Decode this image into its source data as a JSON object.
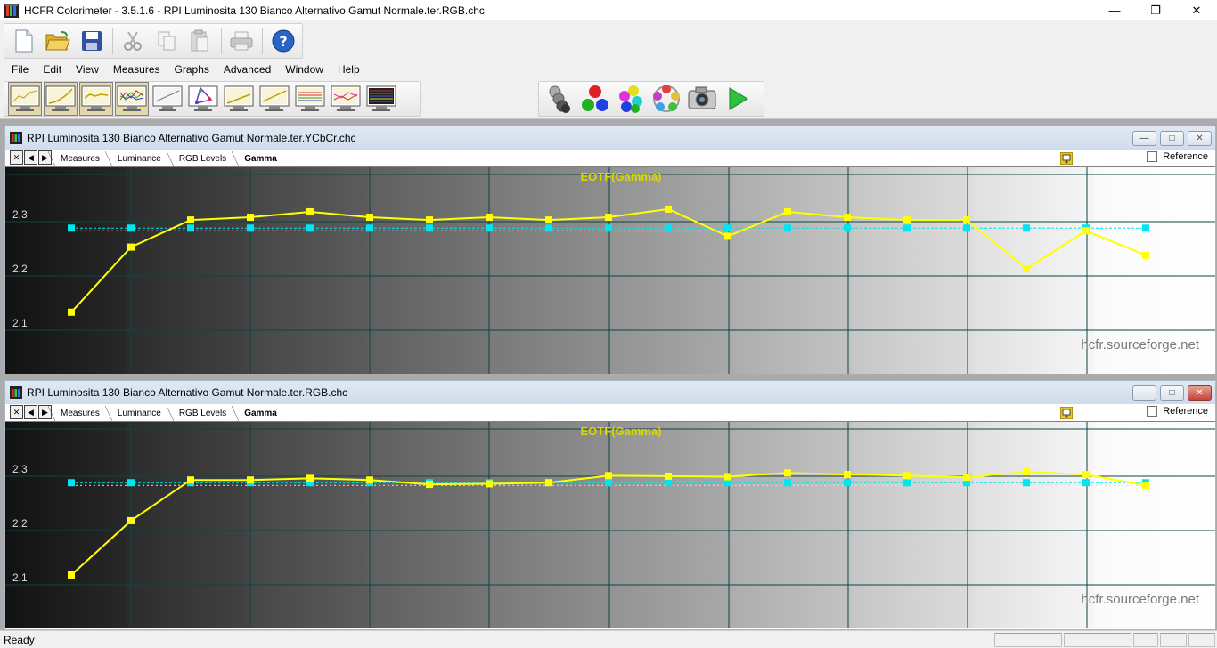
{
  "window": {
    "title": "HCFR Colorimeter - 3.5.1.6 - RPI Luminosita 130 Bianco Alternativo Gamut Normale.ter.RGB.chc",
    "minimize": "—",
    "maximize": "❐",
    "close": "✕"
  },
  "menu": [
    "File",
    "Edit",
    "View",
    "Measures",
    "Graphs",
    "Advanced",
    "Window",
    "Help"
  ],
  "children": [
    {
      "title": "RPI Luminosita 130 Bianco Alternativo Gamut Normale.ter.YCbCr.chc",
      "tabs": [
        "Measures",
        "Luminance",
        "RGB Levels",
        "Gamma"
      ],
      "active_tab": "Gamma",
      "reference_label": "Reference"
    },
    {
      "title": "RPI Luminosita 130 Bianco Alternativo Gamut Normale.ter.RGB.chc",
      "tabs": [
        "Measures",
        "Luminance",
        "RGB Levels",
        "Gamma"
      ],
      "active_tab": "Gamma",
      "reference_label": "Reference"
    }
  ],
  "nav": [
    "✕",
    "◀",
    "▶"
  ],
  "status": {
    "text": "Ready"
  },
  "colors": {
    "gamma_line": "#ffff00",
    "reference_line": "#00e5ee",
    "grid": "#0f4444",
    "title": "#d8d800"
  },
  "chart_data": [
    {
      "type": "line",
      "title": "EOTF(Gamma)",
      "watermark": "hcfr.sourceforge.net",
      "y_ticks": [
        "2.3",
        "2.2",
        "2.1"
      ],
      "ylim": [
        2.05,
        2.39
      ],
      "x": [
        5,
        10,
        15,
        20,
        25,
        30,
        35,
        40,
        45,
        50,
        55,
        60,
        65,
        70,
        75,
        80,
        85,
        90,
        95
      ],
      "series": [
        {
          "values": [
            2.12,
            2.24,
            2.29,
            2.295,
            2.305,
            2.295,
            2.29,
            2.295,
            2.29,
            2.295,
            2.31,
            2.26,
            2.305,
            2.295,
            2.29,
            2.29,
            2.2,
            2.27,
            2.225
          ]
        },
        {
          "values": [
            2.275,
            2.275,
            2.275,
            2.275,
            2.275,
            2.275,
            2.275,
            2.275,
            2.275,
            2.275,
            2.275,
            2.275,
            2.275,
            2.275,
            2.275,
            2.275,
            2.275,
            2.275,
            2.275
          ]
        }
      ]
    },
    {
      "type": "line",
      "title": "EOTF(Gamma)",
      "watermark": "hcfr.sourceforge.net",
      "y_ticks": [
        "2.3",
        "2.2",
        "2.1"
      ],
      "ylim": [
        2.05,
        2.39
      ],
      "x": [
        5,
        10,
        15,
        20,
        25,
        30,
        35,
        40,
        45,
        50,
        55,
        60,
        65,
        70,
        75,
        80,
        85,
        90,
        95
      ],
      "series": [
        {
          "values": [
            2.105,
            2.205,
            2.28,
            2.28,
            2.283,
            2.28,
            2.272,
            2.273,
            2.275,
            2.288,
            2.287,
            2.286,
            2.293,
            2.29,
            2.288,
            2.285,
            2.295,
            2.29,
            2.27
          ]
        },
        {
          "values": [
            2.275,
            2.275,
            2.275,
            2.275,
            2.275,
            2.275,
            2.275,
            2.275,
            2.275,
            2.275,
            2.275,
            2.275,
            2.275,
            2.275,
            2.275,
            2.275,
            2.275,
            2.275,
            2.275
          ]
        }
      ]
    }
  ]
}
